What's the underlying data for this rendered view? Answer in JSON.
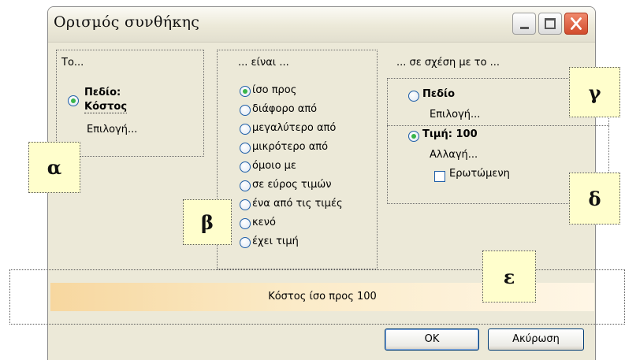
{
  "window": {
    "title": "Ορισμός συνθήκης"
  },
  "groups": {
    "left": {
      "heading": "Το...",
      "field_label": "Πεδίο:",
      "field_value": "Κόστος",
      "choose_link": "Επιλογή..."
    },
    "middle": {
      "heading": "... είναι ...",
      "options": [
        {
          "label": "ίσο προς",
          "selected": true
        },
        {
          "label": "διάφορο από",
          "selected": false
        },
        {
          "label": "μεγαλύτερο από",
          "selected": false
        },
        {
          "label": "μικρότερο από",
          "selected": false
        },
        {
          "label": "όμοιο με",
          "selected": false
        },
        {
          "label": "σε εύρος τιμών",
          "selected": false
        },
        {
          "label": "ένα από τις τιμές",
          "selected": false
        },
        {
          "label": "κενό",
          "selected": false
        },
        {
          "label": "έχει τιμή",
          "selected": false
        }
      ]
    },
    "right": {
      "heading": "... σε σχέση με το ...",
      "field_option": {
        "label": "Πεδίο",
        "selected": false
      },
      "field_choose": "Επιλογή...",
      "value_option": {
        "label": "Τιμή: 100",
        "selected": true
      },
      "value_change": "Αλλαγή...",
      "asked_checkbox": {
        "label": "Ερωτώμενη",
        "checked": false
      }
    }
  },
  "annotations": {
    "a": "α",
    "b": "β",
    "c": "γ",
    "d": "δ",
    "e": "ε"
  },
  "summary": "Κόστος ίσο προς 100",
  "buttons": {
    "ok": "OK",
    "cancel": "Ακύρωση"
  },
  "colors": {
    "radio_dot": "#39b54a",
    "band_start": "#f7d79f",
    "note_bg": "#fffecc",
    "close_button": "#d14b2c"
  }
}
